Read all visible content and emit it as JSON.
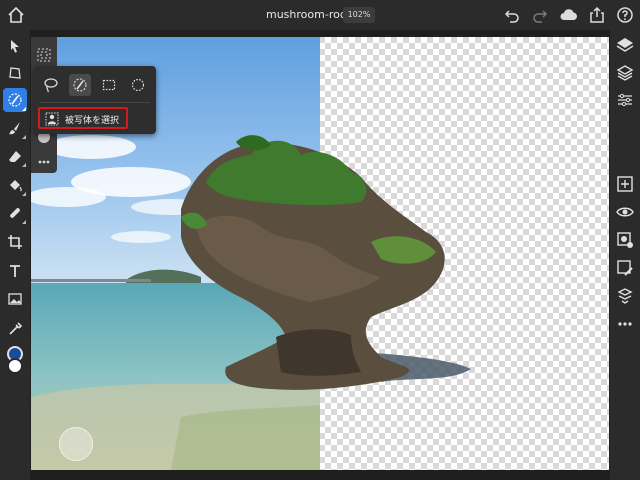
{
  "document": {
    "title": "mushroom-rock *",
    "zoom": "102%"
  },
  "popup": {
    "select_subject_label": "被写体を選択"
  },
  "icons": {
    "home": "home-icon",
    "undo": "undo-icon",
    "redo": "redo-icon",
    "cloud": "cloud-icon",
    "share": "share-icon",
    "help": "help-icon"
  },
  "colors": {
    "accent": "#2f7fe6",
    "highlight": "#d11c1c"
  }
}
